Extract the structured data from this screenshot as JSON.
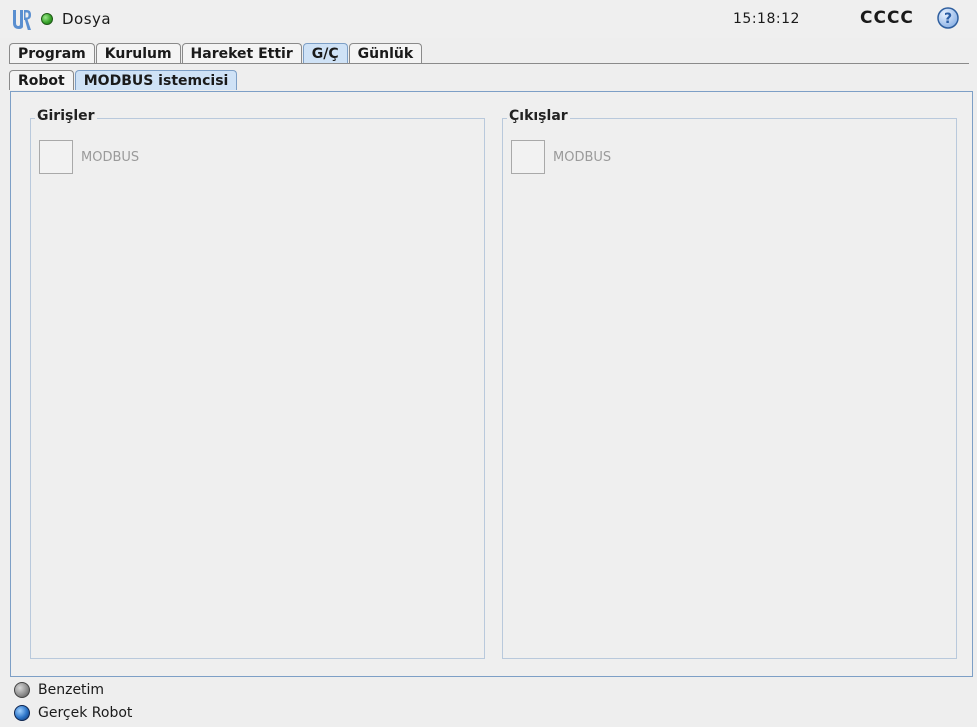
{
  "header": {
    "file_menu": "Dosya",
    "time": "15:18:12",
    "robot_name": "CCCC",
    "status_color": "#3aa52c"
  },
  "main_tabs": [
    {
      "label": "Program",
      "active": false
    },
    {
      "label": "Kurulum",
      "active": false
    },
    {
      "label": "Hareket Ettir",
      "active": false
    },
    {
      "label": "G/Ç",
      "active": true
    },
    {
      "label": "Günlük",
      "active": false
    }
  ],
  "sub_tabs": [
    {
      "label": "Robot",
      "active": false
    },
    {
      "label": "MODBUS istemcisi",
      "active": true
    }
  ],
  "inputs_group": {
    "title": "Girişler",
    "item_label": "MODBUS"
  },
  "outputs_group": {
    "title": "Çıkışlar",
    "item_label": "MODBUS"
  },
  "footer": {
    "simulation_label": "Benzetim",
    "real_robot_label": "Gerçek Robot",
    "selected": "real_robot"
  },
  "colors": {
    "active_tab": "#cfe2f6",
    "panel_border": "#7d9fc6"
  }
}
